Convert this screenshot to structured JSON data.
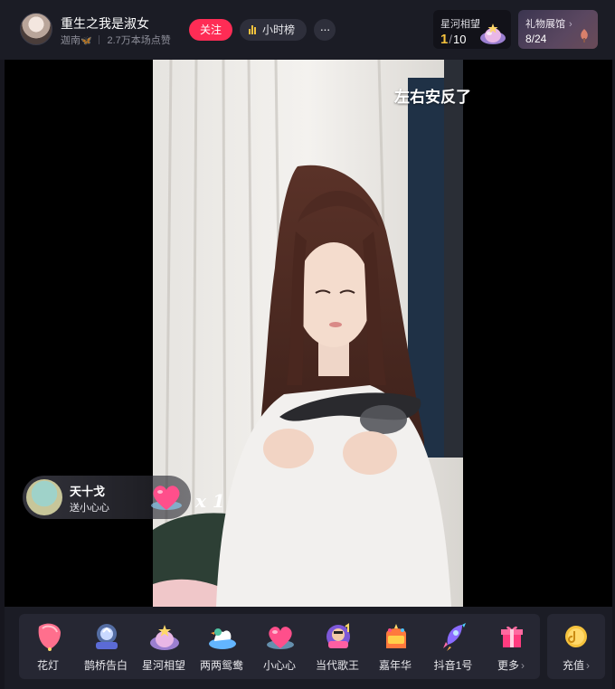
{
  "header": {
    "streamer_name": "重生之我是淑女",
    "streamer_tag": "迦南",
    "likes_text": "2.7万本场点赞",
    "follow_label": "关注",
    "rank_label": "小时榜",
    "more_label": "···"
  },
  "star_card": {
    "title": "星河相望",
    "current": "1",
    "total": "10"
  },
  "gallery_card": {
    "title": "礼物展馆",
    "progress": "8/24"
  },
  "video": {
    "caption": "左右安反了"
  },
  "gift_toast": {
    "sender": "天十戈",
    "action": "送小心心",
    "combo": "x 1"
  },
  "gifts": [
    {
      "label": "花灯",
      "icon": "lantern-icon"
    },
    {
      "label": "鹊桥告白",
      "icon": "magpie-bridge-icon"
    },
    {
      "label": "星河相望",
      "icon": "star-river-icon"
    },
    {
      "label": "两两鸳鸯",
      "icon": "mandarin-duck-icon"
    },
    {
      "label": "小心心",
      "icon": "heart-icon"
    },
    {
      "label": "当代歌王",
      "icon": "singer-icon"
    },
    {
      "label": "嘉年华",
      "icon": "carnival-icon"
    },
    {
      "label": "抖音1号",
      "icon": "rocket-icon"
    },
    {
      "label": "更多",
      "icon": "gift-box-icon"
    }
  ],
  "recharge_label": "充值",
  "colors": {
    "accent": "#fe2c55",
    "gold": "#f5c23d",
    "background": "#1b1c25"
  }
}
